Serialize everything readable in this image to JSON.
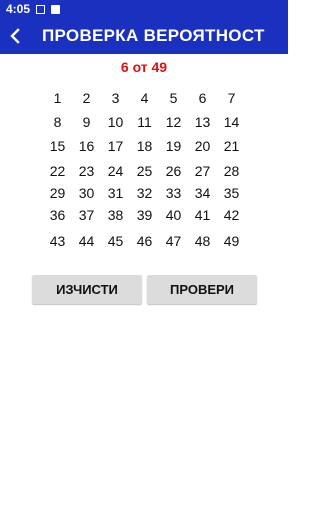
{
  "status_bar": {
    "time": "4:05",
    "icons": [
      "image-icon",
      "notification-icon"
    ]
  },
  "app_bar": {
    "title": "ПРОВЕРКА ВЕРОЯТНОСТ",
    "back_icon": "arrow-left-icon"
  },
  "counter": "6 от 49",
  "numbers": [
    "1",
    "2",
    "3",
    "4",
    "5",
    "6",
    "7",
    "8",
    "9",
    "10",
    "11",
    "12",
    "13",
    "14",
    "15",
    "16",
    "17",
    "18",
    "19",
    "20",
    "21",
    "22",
    "23",
    "24",
    "25",
    "26",
    "27",
    "28",
    "29",
    "30",
    "31",
    "32",
    "33",
    "34",
    "35",
    "36",
    "37",
    "38",
    "39",
    "40",
    "41",
    "42",
    "43",
    "44",
    "45",
    "46",
    "47",
    "48",
    "49"
  ],
  "buttons": {
    "clear_label": "ИЗЧИСТИ",
    "check_label": "ПРОВЕРИ"
  },
  "colors": {
    "primary": "#1a30bf",
    "counter": "#e01010",
    "button_bg": "#dcdcdc"
  }
}
